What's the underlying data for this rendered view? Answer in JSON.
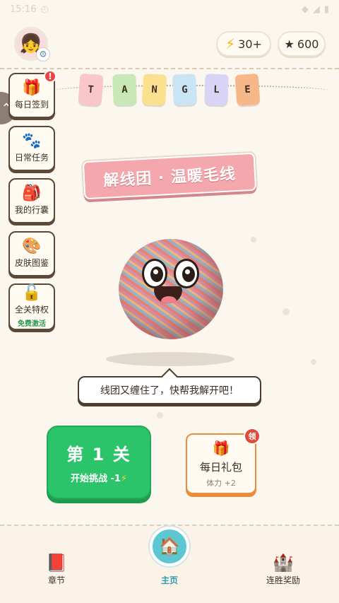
{
  "status": {
    "time": "15:16"
  },
  "header": {
    "energy_value": "30+",
    "stars_value": "600",
    "energy_icon": "lightning-bolt-icon",
    "stars_icon": "star-icon"
  },
  "title_letters": [
    "T",
    "A",
    "N",
    "G",
    "L",
    "E"
  ],
  "flag_colors": [
    "#f9c6c9",
    "#c8e8b8",
    "#fbe08f",
    "#c9e4f5",
    "#d9d3f5",
    "#f7b889"
  ],
  "sidebar": {
    "items": [
      {
        "label": "每日签到",
        "icon": "gift-icon",
        "badge": "!"
      },
      {
        "label": "日常任务",
        "icon": "paw-icon"
      },
      {
        "label": "我的行囊",
        "icon": "backpack-icon"
      },
      {
        "label": "皮肤图鉴",
        "icon": "palette-icon"
      },
      {
        "label": "全关特权",
        "icon": "lock-icon",
        "sub": "免费激活"
      }
    ]
  },
  "banner": {
    "title": "解线团 · 温暖毛线"
  },
  "speech": {
    "text": "线团又缠住了，快帮我解开吧！"
  },
  "play": {
    "level_label": "第 1 关",
    "cost_text": "开始挑战 -1",
    "bolt": "⚡"
  },
  "daily_gift": {
    "label": "每日礼包",
    "sub": "体力 +2",
    "badge": "领"
  },
  "nav": {
    "chapter": "章节",
    "home": "主页",
    "streak": "连胜奖励"
  },
  "colors": {
    "background": "#fbf6ee",
    "play_green": "#2bc46a",
    "banner_pink": "#f4a7ad",
    "home_teal": "#5dc6d3",
    "gift_orange": "#e98d3a"
  }
}
